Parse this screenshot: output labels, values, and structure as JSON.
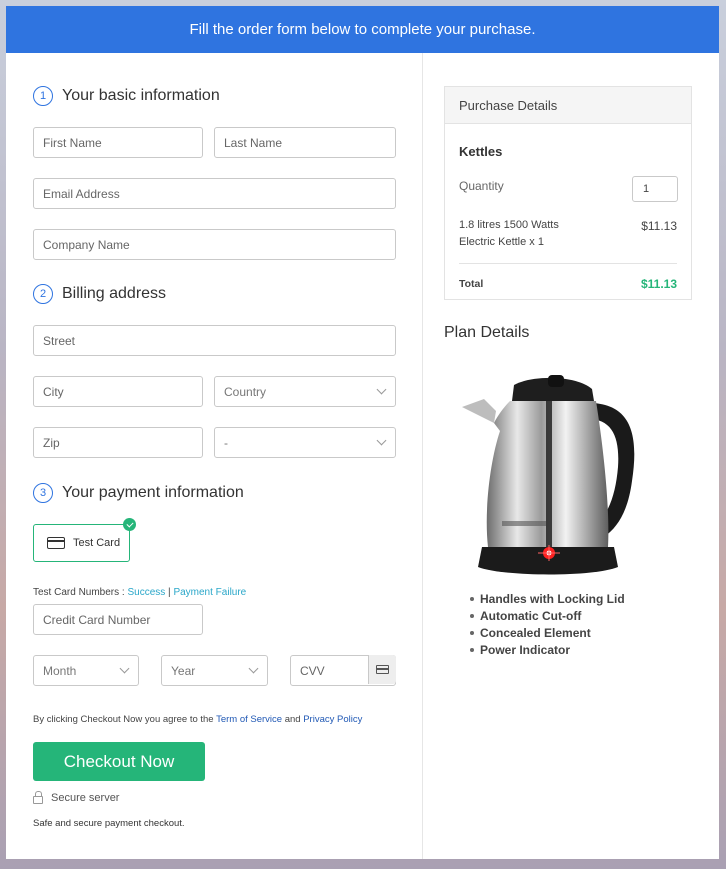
{
  "banner": "Fill the order form below to complete your purchase.",
  "sections": {
    "basic": {
      "num": "1",
      "title": "Your basic information"
    },
    "billing": {
      "num": "2",
      "title": "Billing address"
    },
    "payment": {
      "num": "3",
      "title": "Your payment information"
    }
  },
  "fields": {
    "first_name": "First Name",
    "last_name": "Last Name",
    "email": "Email Address",
    "company": "Company Name",
    "street": "Street",
    "city": "City",
    "country": "Country",
    "zip": "Zip",
    "state": "-",
    "credit_card": "Credit Card Number",
    "month": "Month",
    "year": "Year",
    "cvv": "CVV"
  },
  "payment": {
    "test_card_label": "Test Card",
    "test_numbers_prefix": "Test Card Numbers : ",
    "success": "Success",
    "separator": " | ",
    "failure": "Payment Failure"
  },
  "agreement": {
    "prefix": "By clicking Checkout Now you agree to the ",
    "terms": "Term of Service",
    "and": " and ",
    "privacy": "Privacy Policy"
  },
  "checkout_button": "Checkout Now",
  "secure_server": "Secure server",
  "secure_note": "Safe and secure payment checkout.",
  "purchase_details": {
    "header": "Purchase Details",
    "product": "Kettles",
    "quantity_label": "Quantity",
    "quantity_value": "1",
    "item_line1": "1.8 litres 1500 Watts",
    "item_line2": "Electric Kettle x 1",
    "item_price": "$11.13",
    "total_label": "Total",
    "total_value": "$11.13"
  },
  "plan": {
    "title": "Plan Details",
    "features": [
      "Handles with Locking Lid",
      "Automatic Cut-off",
      "Concealed Element",
      "Power Indicator"
    ]
  },
  "colors": {
    "accent": "#2f74e0",
    "success": "#25b579",
    "link": "#2aa7c9"
  }
}
